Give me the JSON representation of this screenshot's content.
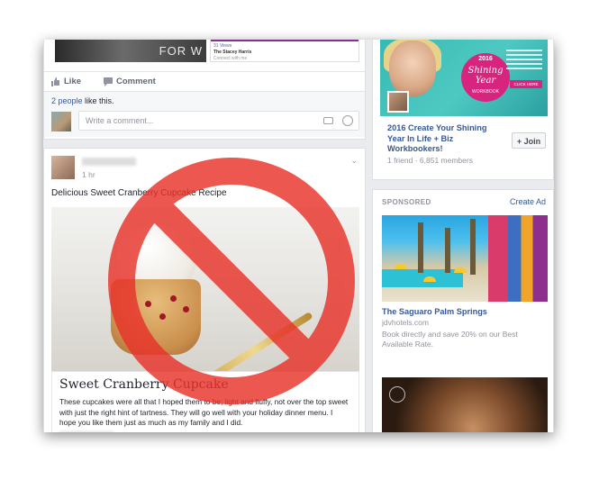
{
  "feed": {
    "post1": {
      "banner_text": "FOR W",
      "side_title": "31 Views",
      "side_name": "The Stacey Harris",
      "side_sub": "Connect with me",
      "like_label": "Like",
      "comment_label": "Comment",
      "likes_count_link": "2 people",
      "likes_suffix": " like this.",
      "comment_placeholder": "Write a comment..."
    },
    "post2": {
      "time": "1 hr",
      "text": "Delicious Sweet Cranberry Cupcake Recipe",
      "card_title": "Sweet Cranberry Cupcake",
      "card_description": "These cupcakes were all that I hoped them to be; light and fluffy, not over the top sweet with just the right hint of tartness. They will go well with your holiday dinner menu. I hope you like them just as much as my family and I did."
    }
  },
  "sidebar": {
    "group": {
      "badge_year": "2016",
      "badge_title": "Shining Year",
      "badge_sub": "WORKBOOK",
      "click_label": "CLICK HERE",
      "title": "2016 Create Your Shining Year In Life + Biz Workbookers!",
      "members": "1 friend · 6,851 members",
      "join_label": "+ Join"
    },
    "sponsored": {
      "label": "SPONSORED",
      "create_ad": "Create Ad",
      "ad1_title": "The Saguaro Palm Springs",
      "ad1_url": "jdvhotels.com",
      "ad1_desc": "Book directly and save 20% on our Best Available Rate."
    }
  },
  "colors": {
    "link": "#365899",
    "ban_red": "#e8332a",
    "background": "#e9ebee"
  }
}
